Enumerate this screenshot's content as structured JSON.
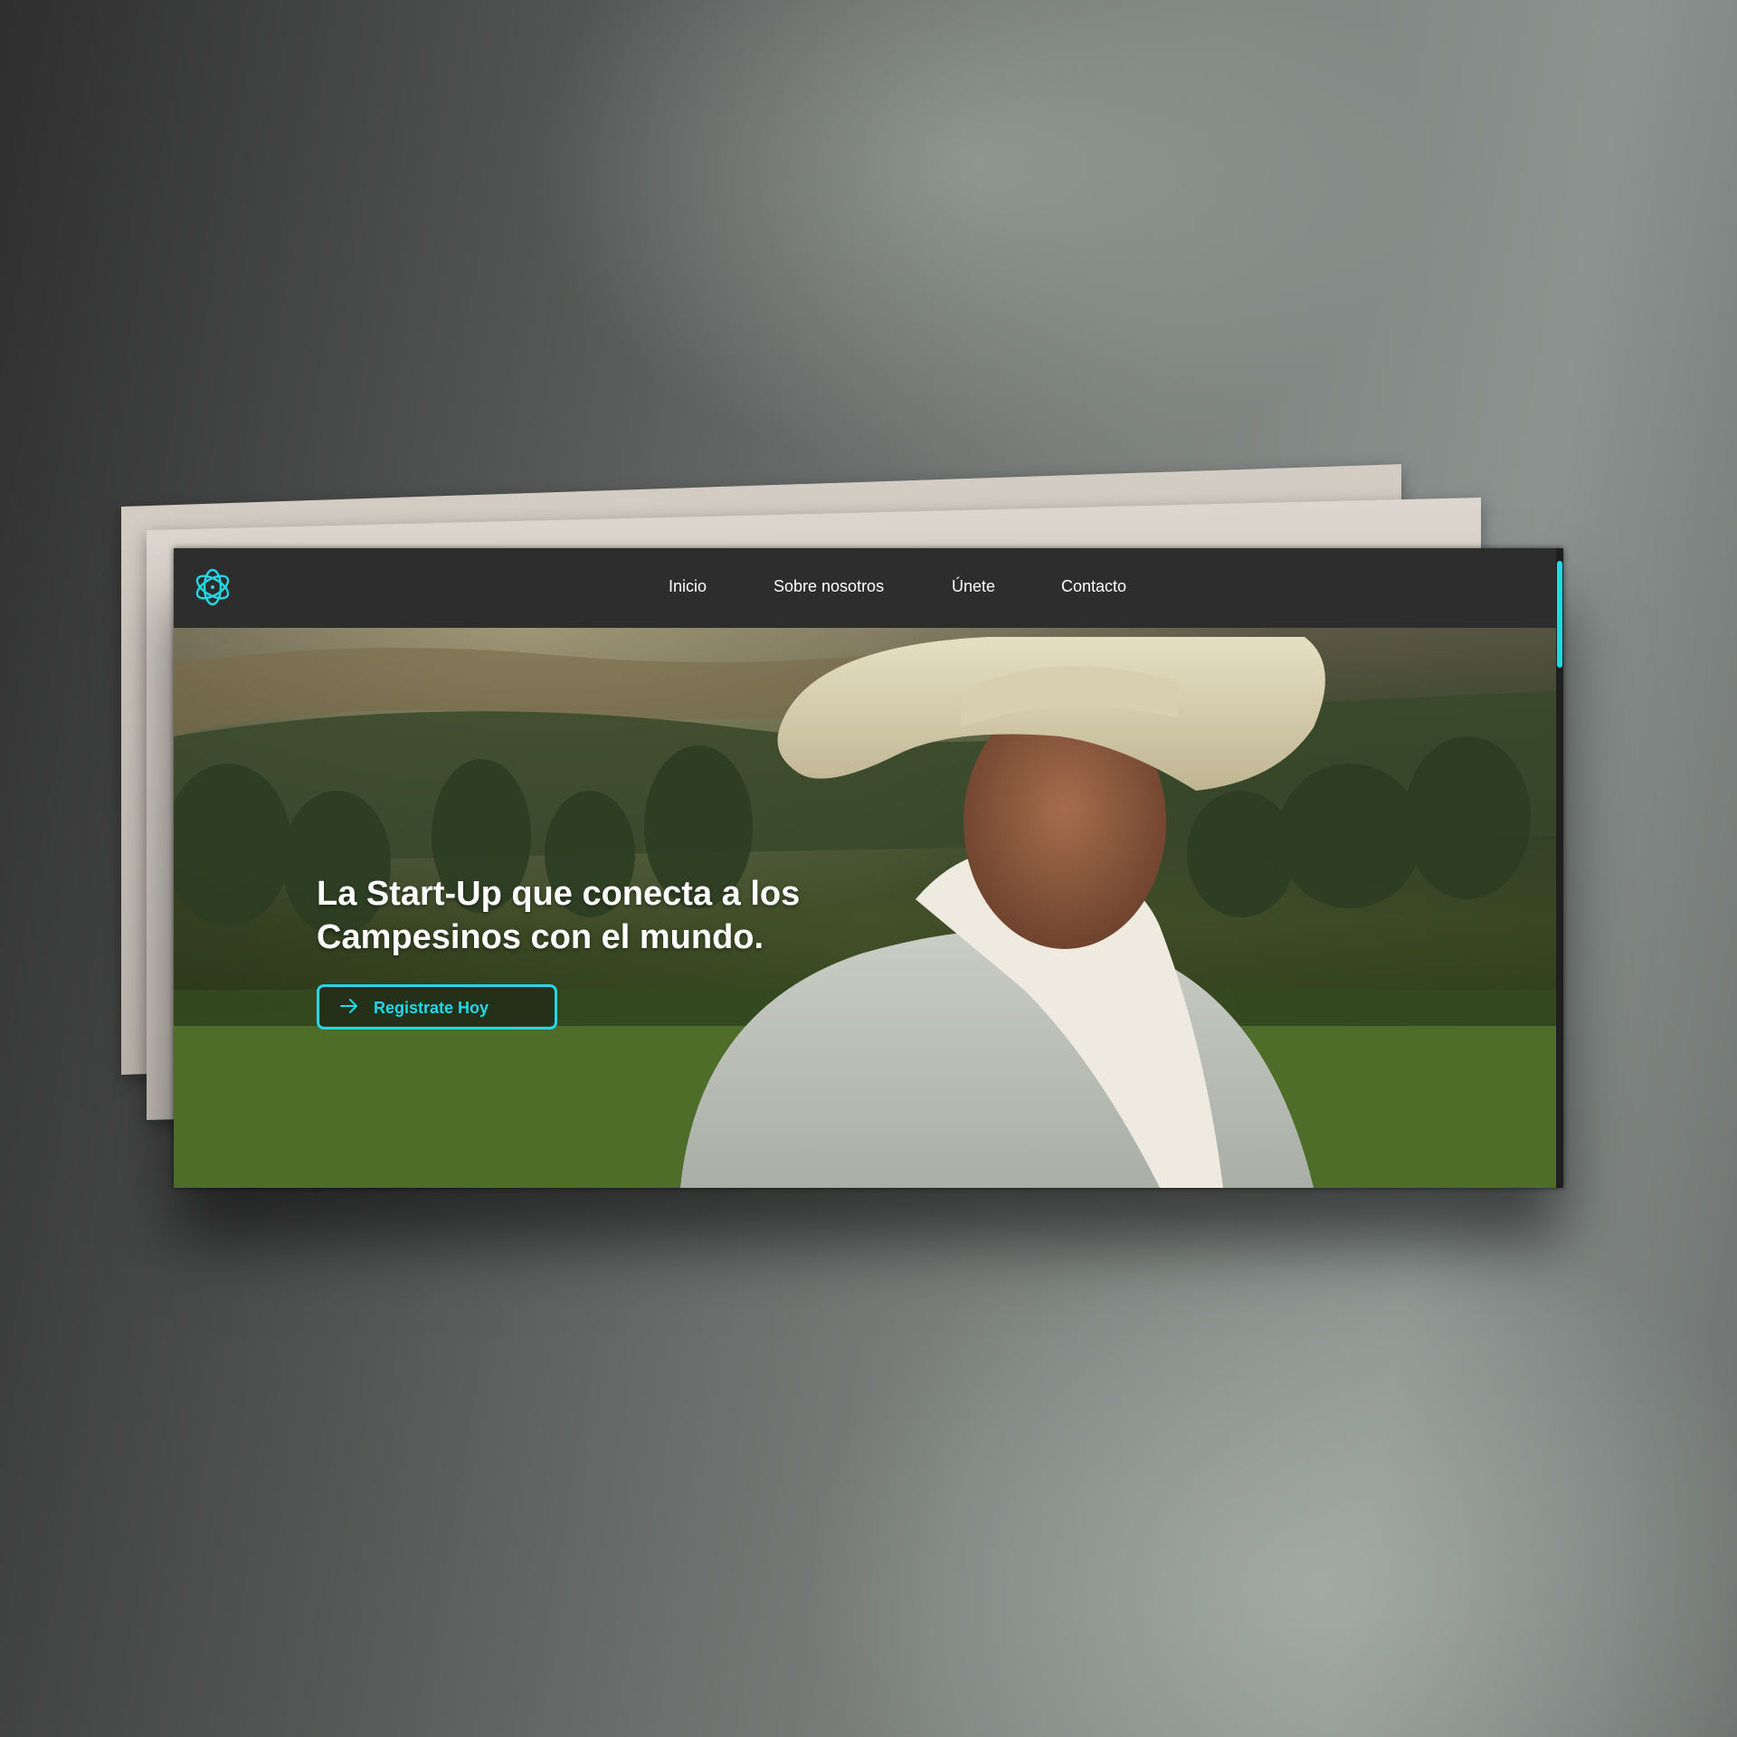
{
  "colors": {
    "accent": "#22d8e6",
    "navbar_bg": "#2e2e2e",
    "headline_text": "#ffffff"
  },
  "navbar": {
    "logo_icon": "atom-swirl-icon",
    "links": [
      {
        "label": "Inicio"
      },
      {
        "label": "Sobre nosotros"
      },
      {
        "label": "Únete"
      },
      {
        "label": "Contacto"
      }
    ]
  },
  "hero": {
    "headline_line1": "La Start-Up que conecta a los",
    "headline_line2": "Campesinos con el mundo.",
    "cta_label": "Registrate Hoy",
    "cta_icon": "arrow-right-icon",
    "image_subject": "farmer-portrait"
  }
}
